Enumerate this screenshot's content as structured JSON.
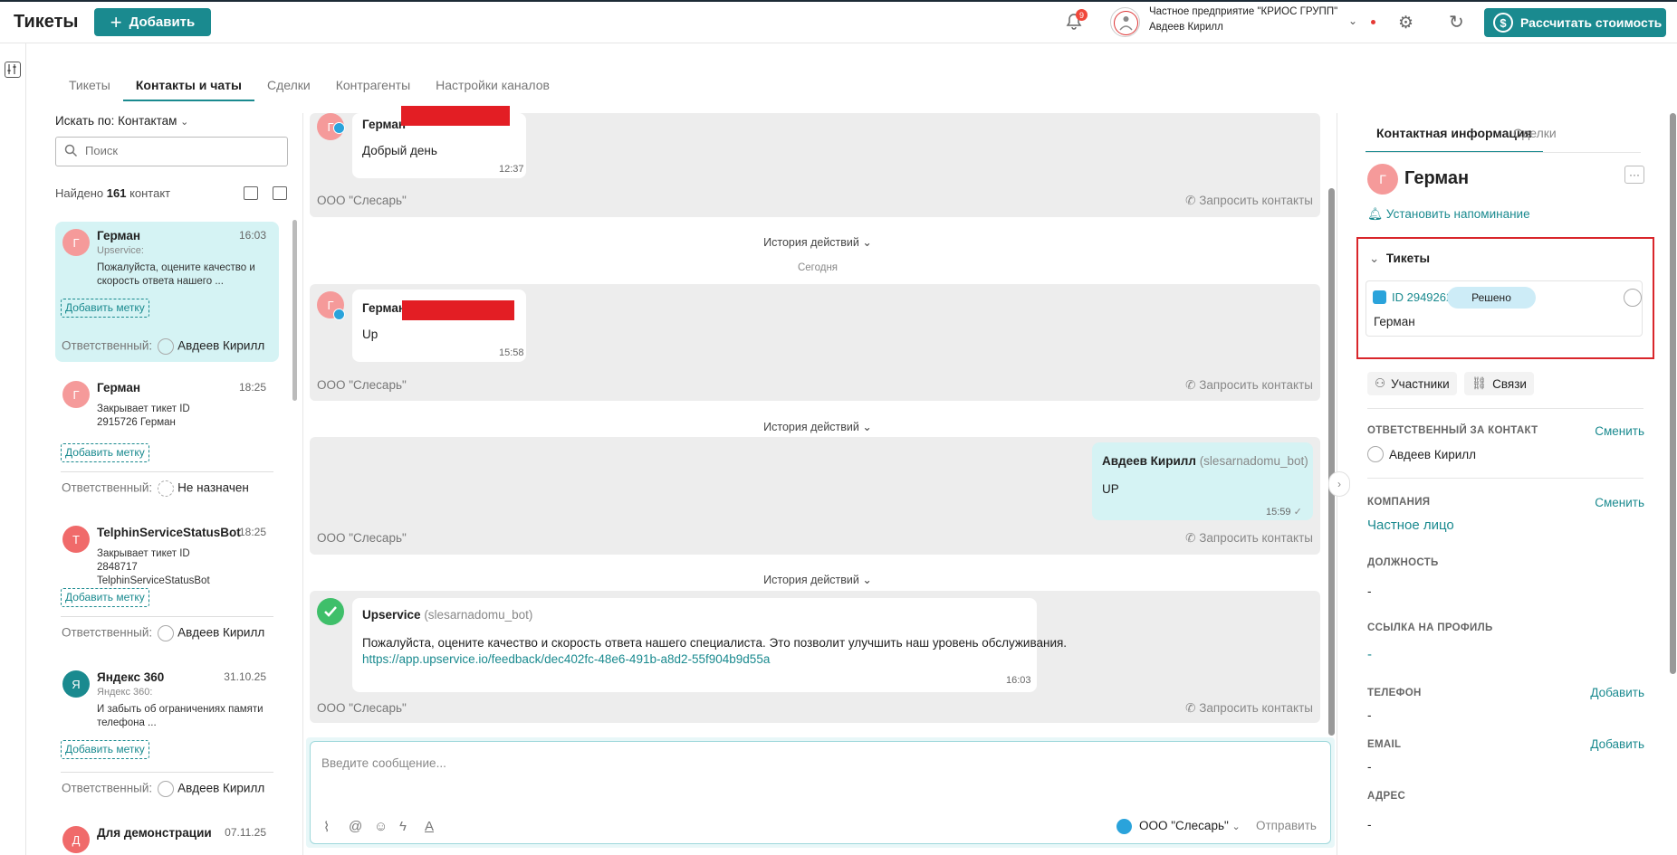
{
  "header": {
    "title": "Тикеты",
    "add_label": "Добавить",
    "notification_count": "9",
    "company_name": "Частное предприятие \"КРИОС ГРУПП\"",
    "user_name": "Авдеев Кирилл",
    "calc_label": "Рассчитать стоимость",
    "accent_color": "#1a8a8f"
  },
  "tabs": [
    "Тикеты",
    "Контакты и чаты",
    "Сделки",
    "Контрагенты",
    "Настройки каналов"
  ],
  "active_tab": "Контакты и чаты",
  "contacts": {
    "search_by": "Искать по: Контактам",
    "search_placeholder": "Поиск",
    "found_prefix": "Найдено",
    "found_count": "161",
    "found_suffix": "контакт",
    "items": [
      {
        "initial": "Г",
        "name": "Герман",
        "time": "16:03",
        "source": "Upservice:",
        "message": "Пожалуйста, оцените качество и скорость ответа нашего ...",
        "tag": "Добавить метку",
        "resp_label": "Ответственный:",
        "resp_name": "Авдеев Кирилл",
        "color": "#f59a9a"
      },
      {
        "initial": "Г",
        "name": "Герман",
        "time": "18:25",
        "source": "",
        "message": "Закрывает тикет ID 2915726 Герман",
        "tag": "Добавить метку",
        "resp_label": "Ответственный:",
        "resp_name": "Не назначен",
        "color": "#f59a9a"
      },
      {
        "initial": "T",
        "name": "TelphinServiceStatusBot",
        "time": "18:25",
        "source": "",
        "message": "Закрывает тикет ID 2848717 TelphinServiceStatusBot",
        "tag": "Добавить метку",
        "resp_label": "Ответственный:",
        "resp_name": "Авдеев Кирилл",
        "color": "#f06a6a"
      },
      {
        "initial": "Я",
        "name": "Яндекс 360",
        "time": "31.10.25",
        "source": "Яндекс 360:",
        "message": "И забыть об ограничениях памяти телефона ...",
        "tag": "Добавить метку",
        "resp_label": "Ответственный:",
        "resp_name": "Авдеев Кирилл",
        "color": "#1a8a8f"
      },
      {
        "initial": "Д",
        "name": "Для демонстрации",
        "time": "07.11.25",
        "source": "",
        "message": "",
        "tag": "",
        "resp_label": "",
        "resp_name": "",
        "color": "#f06a6a"
      }
    ]
  },
  "chat": {
    "org": "ООО \"Слесарь\"",
    "request_contacts": "Запросить контакты",
    "history_label": "История действий",
    "today_label": "Сегодня",
    "messages": [
      {
        "avatar": "Г",
        "author": "Герман",
        "text": "Добрый день",
        "time": "12:37"
      },
      {
        "avatar": "Г",
        "author": "Герман",
        "text": "Up",
        "time": "15:58"
      },
      {
        "author": "Авдеев Кирилл",
        "bot": "(slesarnadomu_bot)",
        "text": "UP",
        "time": "15:59"
      },
      {
        "author": "Upservice",
        "bot": "(slesarnadomu_bot)",
        "text": "Пожалуйста, оцените качество и скорость ответа нашего специалиста. Это позволит улучшить наш уровень обслуживания.",
        "link": "https://app.upservice.io/feedback/dec402fc-48e6-491b-a8d2-55f904b9d55a",
        "time": "16:03"
      }
    ]
  },
  "composer": {
    "placeholder": "Введите сообщение...",
    "channel": "ООО \"Слесарь\"",
    "send_label": "Отправить"
  },
  "contact_panel": {
    "tab_info": "Контактная информация",
    "tab_deals": "Сделки",
    "initial": "Г",
    "name": "Герман",
    "reminder": "Установить напоминание",
    "tickets_title": "Тикеты",
    "ticket_id": "ID 2949262",
    "ticket_status": "Решено",
    "ticket_name": "Герман",
    "participants": "Участники",
    "links": "Связи",
    "responsible_label": "ОТВЕТСТВЕННЫЙ ЗА КОНТАКТ",
    "responsible_action": "Сменить",
    "responsible_name": "Авдеев Кирилл",
    "company_label": "КОМПАНИЯ",
    "company_action": "Сменить",
    "company_value": "Частное лицо",
    "position_label": "ДОЛЖНОСТЬ",
    "position_value": "-",
    "profile_label": "ССЫЛКА НА ПРОФИЛЬ",
    "profile_value": "-",
    "phone_label": "ТЕЛЕФОН",
    "phone_action": "Добавить",
    "phone_value": "-",
    "email_label": "EMAIL",
    "email_action": "Добавить",
    "email_value": "-",
    "address_label": "АДРЕС",
    "address_value": "-"
  }
}
